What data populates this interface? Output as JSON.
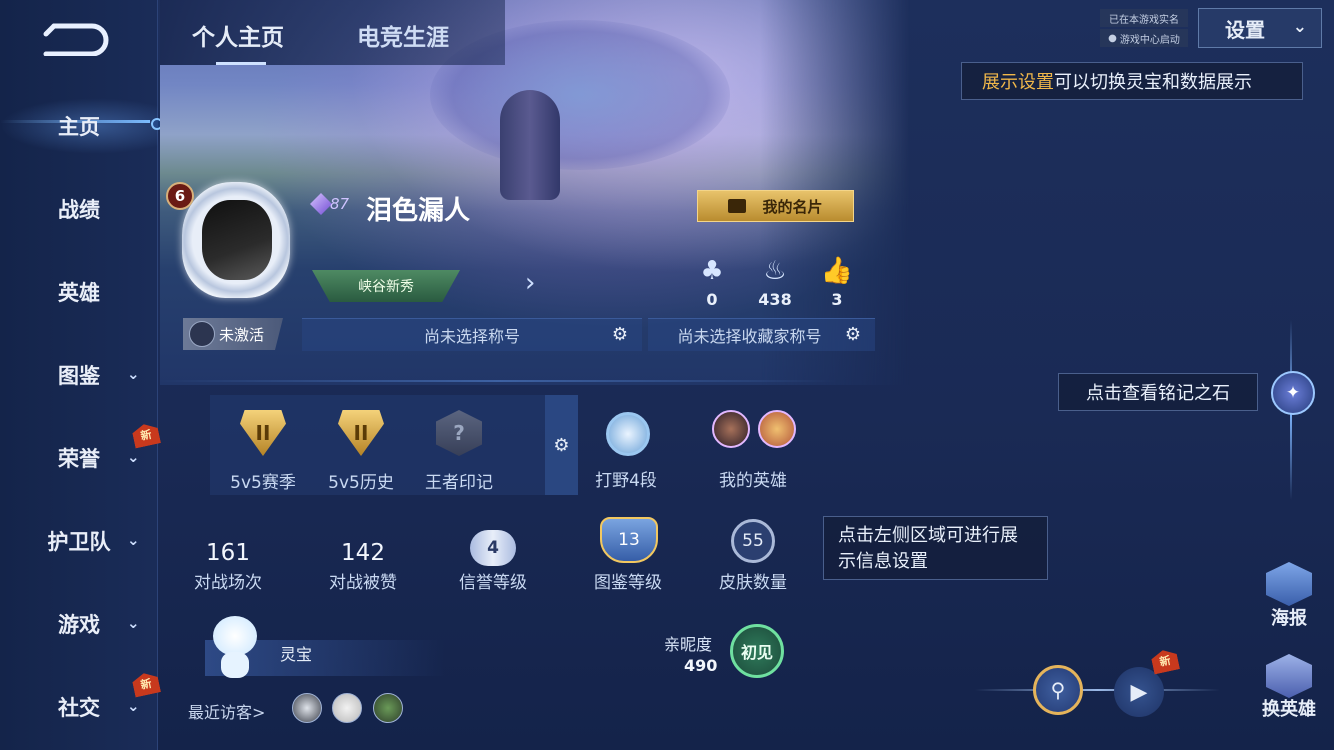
{
  "sidebar": {
    "items": [
      {
        "label": "主页",
        "has_chevron": false,
        "is_new": false,
        "active": true
      },
      {
        "label": "战绩",
        "has_chevron": false,
        "is_new": false
      },
      {
        "label": "英雄",
        "has_chevron": false,
        "is_new": false
      },
      {
        "label": "图鉴",
        "has_chevron": true,
        "is_new": false
      },
      {
        "label": "荣誉",
        "has_chevron": true,
        "is_new": true
      },
      {
        "label": "护卫队",
        "has_chevron": true,
        "is_new": false
      },
      {
        "label": "游戏",
        "has_chevron": true,
        "is_new": false
      },
      {
        "label": "社交",
        "has_chevron": true,
        "is_new": true
      }
    ],
    "new_badge": "新"
  },
  "tabs": [
    {
      "label": "个人主页",
      "active": true
    },
    {
      "label": "电竞生涯",
      "active": false
    }
  ],
  "topright": {
    "realname_line1": "已在本游戏实名",
    "realname_line2": "游戏中心启动",
    "settings_label": "设置",
    "settings_tip_highlight": "展示设置",
    "settings_tip_rest": "可以切换灵宝和数据展示"
  },
  "profile": {
    "level": "6",
    "gem_level": "87",
    "name": "泪色漏人",
    "my_card_label": "我的名片",
    "rank_title": "峡谷新秀",
    "stats": [
      {
        "icon": "sprout-icon",
        "value": "0"
      },
      {
        "icon": "flame-icon",
        "value": "438"
      },
      {
        "icon": "thumbs-up-icon",
        "value": "3"
      }
    ],
    "inactive_label": "未激活",
    "title_slot_1": "尚未选择称号",
    "title_slot_2": "尚未选择收藏家称号"
  },
  "honors": [
    {
      "label": "5v5赛季",
      "badge": "II"
    },
    {
      "label": "5v5历史",
      "badge": "II"
    },
    {
      "label": "王者印记",
      "badge": "?"
    }
  ],
  "jungle": {
    "label": "打野4段"
  },
  "my_heroes": {
    "label": "我的英雄"
  },
  "inscription_tip": "点击查看铭记之石",
  "metrics": [
    {
      "value": "161",
      "label": "对战场次"
    },
    {
      "value": "142",
      "label": "对战被赞"
    },
    {
      "value": "4",
      "label": "信誉等级"
    },
    {
      "value": "13",
      "label": "图鉴等级"
    },
    {
      "value": "55",
      "label": "皮肤数量"
    }
  ],
  "display_tip": "点击左侧区域可进行展示信息设置",
  "pet": {
    "name": "灵宝",
    "intimacy_label": "亲昵度",
    "intimacy_value": "490",
    "stage": "初见"
  },
  "visitors_label": "最近访客>",
  "right_actions": [
    {
      "label": "海报"
    },
    {
      "label": "换英雄"
    }
  ],
  "colors": {
    "accent_gold": "#e8c36b",
    "tip_highlight": "#f0b74a",
    "new_badge": "#c8391d"
  }
}
